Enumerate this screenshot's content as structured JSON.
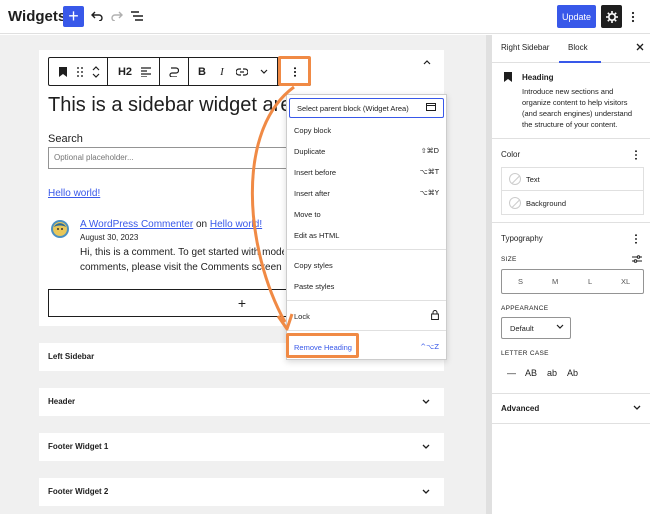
{
  "app": {
    "title": "Widgets",
    "add_symbol": "+",
    "update_label": "Update"
  },
  "toolbar": {
    "heading_level": "H2",
    "bold": "B",
    "italic": "I"
  },
  "editor": {
    "heading": "This is a sidebar widget area",
    "search_label": "Search",
    "search_placeholder": "Optional placeholder...",
    "hello_link": "Hello world!",
    "comment": {
      "author": "A WordPress Commenter",
      "on": "on",
      "post_link": "Hello world!",
      "date": "August 30, 2023",
      "body_line1": "Hi, this is a comment. To get started with moderating,",
      "body_line2": "comments, please visit the Comments screen in the dashboard."
    },
    "appender_symbol": "+"
  },
  "collapsed_areas": [
    "Left Sidebar",
    "Header",
    "Footer Widget 1",
    "Footer Widget 2"
  ],
  "dropdown": {
    "items": [
      {
        "label": "Select parent block (Widget Area)",
        "shortcut": ""
      },
      {
        "label": "Copy block",
        "shortcut": ""
      },
      {
        "label": "Duplicate",
        "shortcut": "⇧⌘D"
      },
      {
        "label": "Insert before",
        "shortcut": "⌥⌘T"
      },
      {
        "label": "Insert after",
        "shortcut": "⌥⌘Y"
      },
      {
        "label": "Move to",
        "shortcut": ""
      },
      {
        "label": "Edit as HTML",
        "shortcut": ""
      },
      {
        "label": "Copy styles",
        "shortcut": ""
      },
      {
        "label": "Paste styles",
        "shortcut": ""
      },
      {
        "label": "Lock",
        "shortcut": ""
      },
      {
        "label": "Remove Heading",
        "shortcut": "^⌥Z"
      }
    ]
  },
  "sidebar": {
    "tabs": [
      "Right Sidebar",
      "Block"
    ],
    "active_tab": "Block",
    "block_card": {
      "title": "Heading",
      "description": "Introduce new sections and organize content to help visitors (and search engines) understand the structure of your content."
    },
    "color": {
      "title": "Color",
      "options": [
        "Text",
        "Background"
      ]
    },
    "typography": {
      "title": "Typography",
      "size_label": "SIZE",
      "sizes": [
        "S",
        "M",
        "L",
        "XL"
      ],
      "appearance_label": "APPEARANCE",
      "appearance_value": "Default",
      "letter_case_label": "LETTER CASE",
      "letter_case_options": [
        "—",
        "AB",
        "ab",
        "Ab"
      ]
    },
    "advanced": {
      "title": "Advanced"
    }
  },
  "colors": {
    "accent": "#3858e9",
    "highlight": "#f08a45"
  }
}
